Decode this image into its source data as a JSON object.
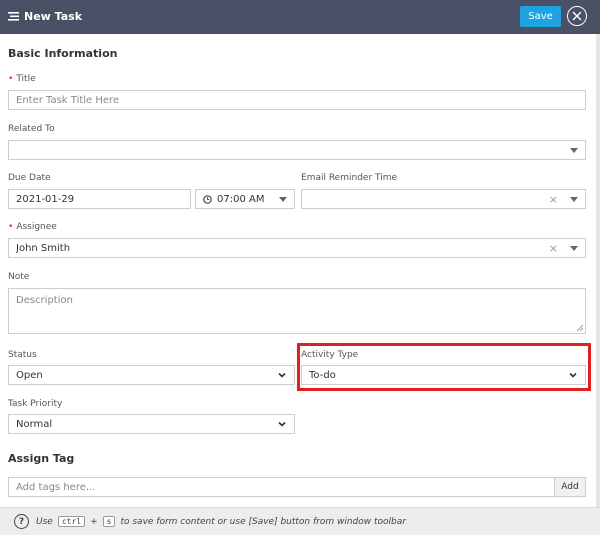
{
  "header": {
    "title": "New Task",
    "save_label": "Save"
  },
  "basic_info": {
    "title": "Basic Information"
  },
  "title_field": {
    "label": "Title",
    "placeholder": "Enter Task Title Here"
  },
  "related_to": {
    "label": "Related To",
    "value": ""
  },
  "due_date": {
    "label": "Due Date",
    "value": "2021-01-29",
    "time": "07:00 AM"
  },
  "email_reminder": {
    "label": "Email Reminder Time",
    "value": ""
  },
  "assignee": {
    "label": "Assignee",
    "value": "John Smith"
  },
  "note": {
    "label": "Note",
    "placeholder": "Description"
  },
  "status": {
    "label": "Status",
    "value": "Open"
  },
  "activity_type": {
    "label": "Activity Type",
    "value": "To-do"
  },
  "task_priority": {
    "label": "Task Priority",
    "value": "Normal"
  },
  "assign_tag": {
    "title": "Assign Tag",
    "placeholder": "Add tags here...",
    "add_label": "Add"
  },
  "footer": {
    "use": "Use",
    "key_ctrl": "ctrl",
    "plus": "+",
    "key_s": "s",
    "text": "to save form content or use [Save] button from window toolbar",
    "help_glyph": "?"
  },
  "colors": {
    "header_bg": "#4a5166",
    "accent": "#1fa2e0",
    "highlight": "#e02020",
    "required": "#d9342b"
  }
}
